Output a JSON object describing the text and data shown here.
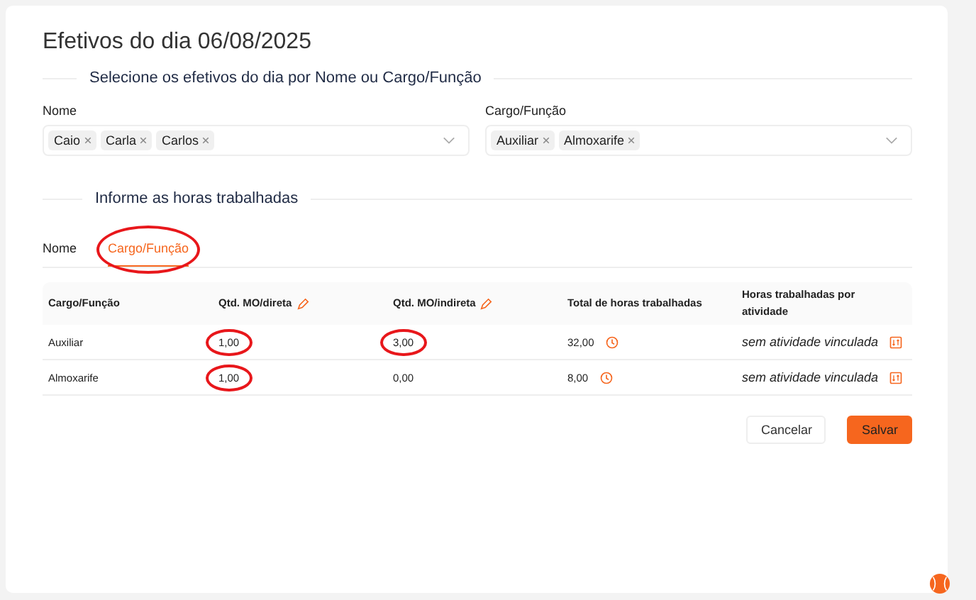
{
  "title": "Efetivos do dia 06/08/2025",
  "select_section": {
    "heading": "Selecione os efetivos do dia por Nome ou Cargo/Função",
    "fields": [
      {
        "label": "Nome",
        "tags": [
          "Caio",
          "Carla",
          "Carlos"
        ]
      },
      {
        "label": "Cargo/Função",
        "tags": [
          "Auxiliar",
          "Almoxarife"
        ]
      }
    ]
  },
  "hours_section": {
    "heading": "Informe as horas trabalhadas",
    "tabs": [
      {
        "label": "Nome",
        "selected": false,
        "circled": false
      },
      {
        "label": "Cargo/Função",
        "selected": true,
        "circled": true
      }
    ]
  },
  "table": {
    "columns": [
      {
        "label": "Cargo/Função",
        "editable": false
      },
      {
        "label": "Qtd. MO/direta",
        "editable": true
      },
      {
        "label": "Qtd. MO/indireta",
        "editable": true
      },
      {
        "label": "Total de horas trabalhadas",
        "editable": false
      },
      {
        "label": "Horas trabalhadas por atividade",
        "editable": false
      }
    ],
    "rows": [
      {
        "role": "Auxiliar",
        "direct": {
          "value": "1,00",
          "circled": true
        },
        "indirect": {
          "value": "3,00",
          "circled": true
        },
        "total": "32,00",
        "activity": "sem atividade vinculada"
      },
      {
        "role": "Almoxarife",
        "direct": {
          "value": "1,00",
          "circled": true
        },
        "indirect": {
          "value": "0,00",
          "circled": false
        },
        "total": "8,00",
        "activity": "sem atividade vinculada"
      }
    ]
  },
  "buttons": [
    {
      "label": "Cancelar",
      "kind": "secondary"
    },
    {
      "label": "Salvar",
      "kind": "primary"
    }
  ]
}
